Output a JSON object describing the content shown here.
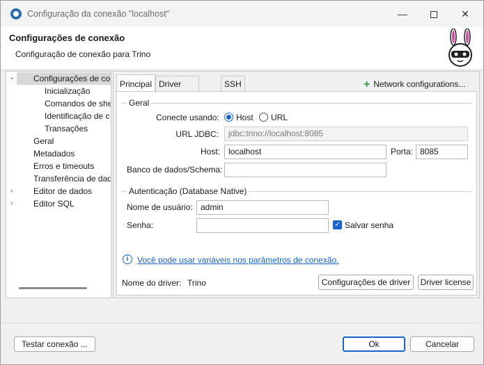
{
  "window": {
    "title": "Configuração da conexão \"localhost\""
  },
  "header": {
    "title": "Configurações de conexão",
    "subtitle": "Configuração de conexão para Trino"
  },
  "tree": {
    "items": [
      {
        "label": "Configurações de co"
      },
      {
        "label": "Inicialização"
      },
      {
        "label": "Comandos de she"
      },
      {
        "label": "Identificação de c"
      },
      {
        "label": "Transações"
      },
      {
        "label": "Geral"
      },
      {
        "label": "Metadados"
      },
      {
        "label": "Erros e timeouts"
      },
      {
        "label": "Transferência de dad"
      },
      {
        "label": "Editor de dados"
      },
      {
        "label": "Editor SQL"
      }
    ]
  },
  "tabs": [
    {
      "label": "Principal"
    },
    {
      "label": "Driver properties"
    },
    {
      "label": "SSH"
    }
  ],
  "network_config_label": "Network configurations...",
  "general": {
    "title": "Geral",
    "connect_using_label": "Conecte usando:",
    "option_host": "Host",
    "option_url": "URL",
    "selected": "Host",
    "jdbc_label": "URL JDBC:",
    "jdbc_value": "jdbc:trino://localhost:8085",
    "host_label": "Host:",
    "host_value": "localhost",
    "port_label": "Porta:",
    "port_value": "8085",
    "db_label": "Banco de dados/Schema:",
    "db_value": ""
  },
  "auth": {
    "title": "Autenticação (Database Native)",
    "user_label": "Nome de usuário:",
    "user_value": "admin",
    "pass_label": "Senha:",
    "pass_value": "",
    "save_password_label": "Salvar senha",
    "save_password_checked": true
  },
  "info_link": "Você pode usar variáveis nos parâmetros de conexão.",
  "driver": {
    "name_label": "Nome do driver:",
    "name_value": "Trino",
    "settings_button": "Configurações de driver",
    "license_button": "Driver license"
  },
  "footer": {
    "test_button": "Testar conexão ...",
    "ok_button": "Ok",
    "cancel_button": "Cancelar"
  }
}
